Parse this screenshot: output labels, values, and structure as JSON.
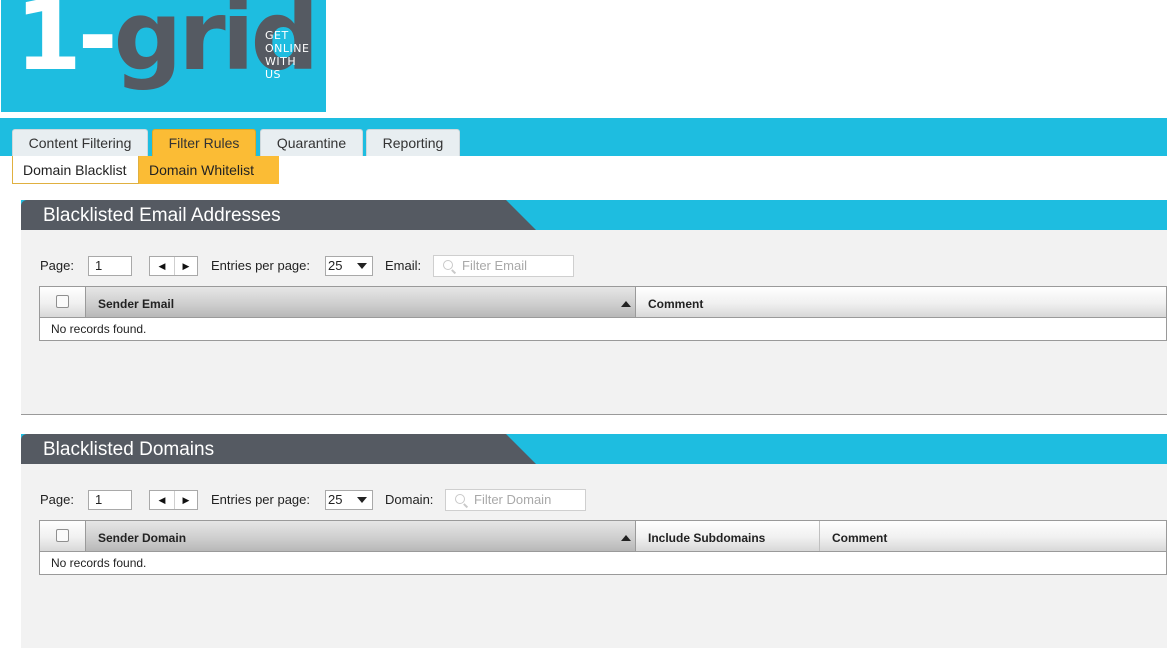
{
  "logo": {
    "mark_one": "1-",
    "mark_grid": "grid",
    "tagline": [
      "GET",
      "ONLINE",
      "WITH",
      "US"
    ],
    "colors": {
      "background": "#1ebde0",
      "one": "#ffffff",
      "grid": "#555a62"
    }
  },
  "tabs": [
    {
      "label": "Content Filtering",
      "active": false
    },
    {
      "label": "Filter Rules",
      "active": true
    },
    {
      "label": "Quarantine",
      "active": false
    },
    {
      "label": "Reporting",
      "active": false
    }
  ],
  "subtabs": [
    {
      "label": "Domain Blacklist",
      "active": false
    },
    {
      "label": "Domain Whitelist",
      "active": true
    }
  ],
  "colors": {
    "accent": "#1ebde0",
    "active_tab": "#fbbc35",
    "panel_title_bg": "#555a62",
    "panel_bg": "#f2f2f2"
  },
  "sections": {
    "emails": {
      "title": "Blacklisted Email Addresses",
      "page_label": "Page:",
      "page_value": "1",
      "entries_label": "Entries per page:",
      "entries_value": "25",
      "filter_label": "Email:",
      "filter_placeholder": "Filter Email",
      "columns": [
        "Sender Email",
        "Comment"
      ],
      "empty_text": "No records found."
    },
    "domains": {
      "title": "Blacklisted Domains",
      "page_label": "Page:",
      "page_value": "1",
      "entries_label": "Entries per page:",
      "entries_value": "25",
      "filter_label": "Domain:",
      "filter_placeholder": "Filter Domain",
      "columns": [
        "Sender Domain",
        "Include Subdomains",
        "Comment"
      ],
      "empty_text": "No records found."
    }
  },
  "icons": {
    "prev": "caret-left-icon",
    "next": "caret-right-icon",
    "sort": "sort-asc-icon",
    "dropdown": "chevron-down-icon",
    "search": "search-icon"
  }
}
